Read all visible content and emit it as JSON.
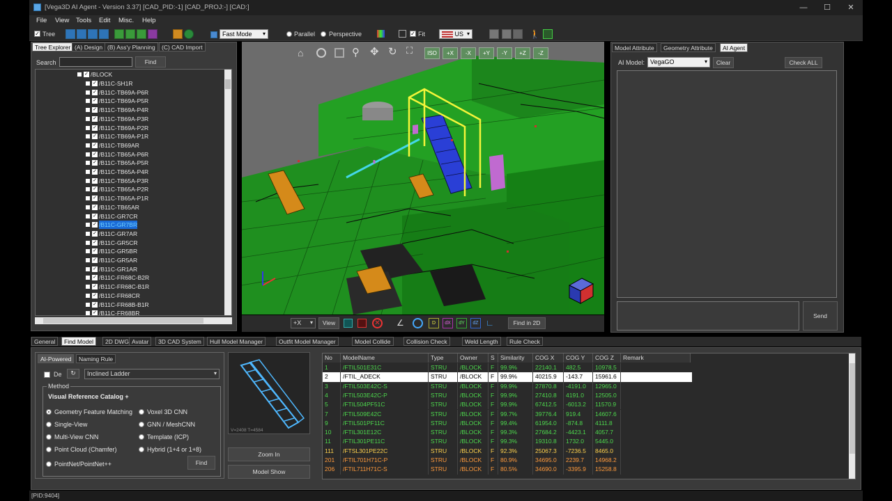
{
  "window": {
    "title": "[Vega3D AI Agent - Version 3.37] [CAD_PID:-1] [CAD_PROJ:-] [CAD:]",
    "minimize": "—",
    "maximize": "☐",
    "close": "✕"
  },
  "menu": [
    "File",
    "View",
    "Tools",
    "Edit",
    "Misc.",
    "Help"
  ],
  "toolbar": {
    "tree_label": "Tree",
    "mode_value": "Fast Mode",
    "parallel_label": "Parallel",
    "perspective_label": "Perspective",
    "fit_label": "Fit",
    "locale_value": "US"
  },
  "left": {
    "tabs": [
      "Tree Explorer",
      "(A) Design",
      "(B) Ass'y Planning",
      "(C) CAD Import"
    ],
    "search_label": "Search",
    "find_label": "Find",
    "root": "/BLOCK",
    "items": [
      "/B11C-SH1R",
      "/B11C-TB69A-P6R",
      "/B11C-TB69A-P5R",
      "/B11C-TB69A-P4R",
      "/B11C-TB69A-P3R",
      "/B11C-TB69A-P2R",
      "/B11C-TB69A-P1R",
      "/B11C-TB69AR",
      "/B11C-TB65A-P6R",
      "/B11C-TB65A-P5R",
      "/B11C-TB65A-P4R",
      "/B11C-TB65A-P3R",
      "/B11C-TB65A-P2R",
      "/B11C-TB65A-P1R",
      "/B11C-TB65AR",
      "/B11C-GR7CR",
      "/B11C-GR7BR",
      "/B11C-GR7AR",
      "/B11C-GR5CR",
      "/B11C-GR5BR",
      "/B11C-GR5AR",
      "/B11C-GR1AR",
      "/B11C-FR68C-B2R",
      "/B11C-FR68C-B1R",
      "/B11C-FR68CR",
      "/B11C-FR68B-B1R",
      "/B11C-FR68BR"
    ],
    "selected_index": 16
  },
  "viewport": {
    "view_buttons": [
      "ISO",
      "+X",
      "-X",
      "+Y",
      "-Y",
      "+Z",
      "-Z"
    ],
    "axis_value": "+X",
    "view_label": "View",
    "find2d_label": "Find in 2D"
  },
  "right": {
    "tabs": [
      "Model Attribute",
      "Geometry Attribute",
      "AI Agent"
    ],
    "model_label": "AI Model:",
    "model_value": "VegaGO",
    "clear_label": "Clear",
    "checkall_label": "Check ALL",
    "send_label": "Send"
  },
  "bottom": {
    "tabs": [
      "General",
      "Find Model",
      "2D DWG",
      "Avatar",
      "3D CAD System",
      "Hull Model Manager",
      "Outfit Model Manager",
      "Model Collide",
      "Collision Check",
      "Weld Length",
      "Rule Check"
    ],
    "subtabs": [
      "AI-Powered",
      "Naming Rule"
    ],
    "de_label": "De",
    "category_value": "Inclined Ladder",
    "method_label": "Method",
    "catalog_label": "Visual Reference Catalog +",
    "methods_left": [
      "Geometry Feature Matching",
      "Single-View",
      "Multi-View CNN",
      "Point Cloud (Chamfer)",
      "PointNet/PointNet++"
    ],
    "methods_right": [
      "Voxel 3D CNN",
      "GNN / MeshCNN",
      "Template (ICP)",
      "Hybrid (1+4 or 1+8)"
    ],
    "find_label": "Find",
    "preview_caption": "V=2408 T=4584",
    "zoomin_label": "Zoom In",
    "modelshow_label": "Model Show"
  },
  "results": {
    "headers": [
      "No",
      "ModelName",
      "Type",
      "Owner",
      "S",
      "Similarity",
      "COG X",
      "COG Y",
      "COG Z",
      "Remark"
    ],
    "rows": [
      [
        "1",
        "/FTIL501E31C",
        "STRU",
        "/BLOCK",
        "F",
        "99.9%",
        "22140.1",
        "482.5",
        "10978.5"
      ],
      [
        "2",
        "/FTIL_ADECK",
        "STRU",
        "/BLOCK",
        "F",
        "99.9%",
        "40215.9",
        "-143.7",
        "15961.6"
      ],
      [
        "3",
        "/FTIL503E42C-S",
        "STRU",
        "/BLOCK",
        "F",
        "99.9%",
        "27870.8",
        "-4191.0",
        "12965.0"
      ],
      [
        "4",
        "/FTIL503E42C-P",
        "STRU",
        "/BLOCK",
        "F",
        "99.9%",
        "27410.8",
        "4191.0",
        "12505.0"
      ],
      [
        "5",
        "/FTIL504PF51C",
        "STRU",
        "/BLOCK",
        "F",
        "99.9%",
        "67412.5",
        "-6013.2",
        "11570.9"
      ],
      [
        "7",
        "/FTIL509E42C",
        "STRU",
        "/BLOCK",
        "F",
        "99.7%",
        "39776.4",
        "919.4",
        "14607.6"
      ],
      [
        "9",
        "/FTIL501PF11C",
        "STRU",
        "/BLOCK",
        "F",
        "99.4%",
        "61954.0",
        "-874.8",
        "4111.8"
      ],
      [
        "10",
        "/FTIL301E12C",
        "STRU",
        "/BLOCK",
        "F",
        "99.3%",
        "27684.2",
        "-4423.1",
        "4057.7"
      ],
      [
        "11",
        "/FTIL301PE11C",
        "STRU",
        "/BLOCK",
        "F",
        "99.3%",
        "19310.8",
        "1732.0",
        "5445.0"
      ],
      [
        "111",
        "/FTSL301PE22C",
        "STRU",
        "/BLOCK",
        "F",
        "92.3%",
        "25067.3",
        "-7236.5",
        "8465.0"
      ],
      [
        "201",
        "/FTIL701H71C-P",
        "STRU",
        "/BLOCK",
        "F",
        "80.9%",
        "34695.0",
        "2239.7",
        "14968.2"
      ],
      [
        "206",
        "/FTIL711H71C-S",
        "STRU",
        "/BLOCK",
        "F",
        "80.5%",
        "34690.0",
        "-3395.9",
        "15258.8"
      ]
    ],
    "row_colors": [
      "#4dd94d",
      "#000000",
      "#4dd94d",
      "#4dd94d",
      "#4dd94d",
      "#4dd94d",
      "#4dd94d",
      "#4dd94d",
      "#4dd94d",
      "#ffd24d",
      "#ff9a3c",
      "#ff9a3c"
    ],
    "selected_row": 1
  },
  "status": "[PID:9404]",
  "colors": {
    "green_model": "#1f8f1f",
    "highlight_yellow": "#f5f53a",
    "stair_blue": "#2a3fd6",
    "pipe_cyan": "#44d7e8",
    "text_green": "#4dd94d",
    "text_yellow": "#ffd24d",
    "text_orange": "#ff9a3c"
  }
}
